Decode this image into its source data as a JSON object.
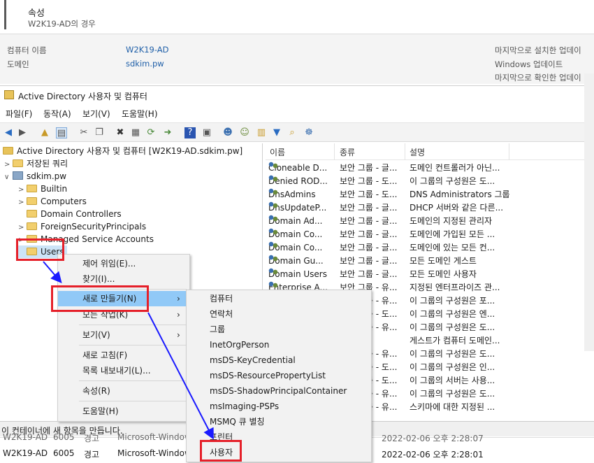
{
  "properties": {
    "title": "속성",
    "subtitle": "W2K19-AD의 경우",
    "computer_name_label": "컴퓨터 이름",
    "computer_name_value": "W2K19-AD",
    "domain_label": "도메인",
    "domain_value": "sdkim.pw",
    "right_items": [
      "마지막으로 설치한 업데이",
      "Windows 업데이트",
      "마지막으로 확인한 업데이"
    ]
  },
  "window": {
    "title": "Active Directory 사용자 및 컴퓨터",
    "close": "×"
  },
  "menubar": [
    "파일(F)",
    "동작(A)",
    "보기(V)",
    "도움말(H)"
  ],
  "tree": {
    "root": "Active Directory 사용자 및 컴퓨터 [W2K19-AD.sdkim.pw]",
    "saved_queries": "저장된 쿼리",
    "domain": "sdkim.pw",
    "children": [
      "Builtin",
      "Computers",
      "Domain Controllers",
      "ForeignSecurityPrincipals",
      "Managed Service Accounts",
      "Users"
    ]
  },
  "list": {
    "columns": [
      "이름",
      "종류",
      "설명"
    ],
    "rows": [
      {
        "name": "Cloneable D...",
        "type": "보안 그룹 - 글...",
        "desc": "도메인 컨트롤러가 아닌..."
      },
      {
        "name": "Denied ROD...",
        "type": "보안 그룹 - 도...",
        "desc": "이 그룹의 구성원은 도..."
      },
      {
        "name": "DnsAdmins",
        "type": "보안 그룹 - 도...",
        "desc": "DNS Administrators 그룹"
      },
      {
        "name": "DnsUpdateP...",
        "type": "보안 그룹 - 글...",
        "desc": "DHCP 서버와 같은 다른..."
      },
      {
        "name": "Domain Ad...",
        "type": "보안 그룹 - 글...",
        "desc": "도메인의 지정된 관리자"
      },
      {
        "name": "Domain Co...",
        "type": "보안 그룹 - 글...",
        "desc": "도메인에 가입된 모든 ..."
      },
      {
        "name": "Domain Co...",
        "type": "보안 그룹 - 글...",
        "desc": "도메인에 있는 모든 컨..."
      },
      {
        "name": "Domain Gu...",
        "type": "보안 그룹 - 글...",
        "desc": "모든 도메인 게스트"
      },
      {
        "name": "Domain Users",
        "type": "보안 그룹 - 글...",
        "desc": "모든 도메인 사용자"
      },
      {
        "name": "Enterprise A...",
        "type": "보안 그룹 - 유...",
        "desc": "지정된 엔터프라이즈 관..."
      },
      {
        "name": "",
        "type": "보안 그룹 - 유...",
        "desc": "이 그룹의 구성원은 포..."
      },
      {
        "name": "",
        "type": "보안 그룹 - 도...",
        "desc": "이 그룹의 구성원은 엔..."
      },
      {
        "name": "",
        "type": "보안 그룹 - 유...",
        "desc": "이 그룹의 구성원은 도..."
      },
      {
        "name": "",
        "type": "",
        "desc": "게스트가 컴퓨터 도메인..."
      },
      {
        "name": "",
        "type": "보안 그룹 - 유...",
        "desc": "이 그룹의 구성원은 도..."
      },
      {
        "name": "",
        "type": "보안 그룹 - 도...",
        "desc": "이 그룹의 구성원은 인..."
      },
      {
        "name": "",
        "type": "보안 그룹 - 도...",
        "desc": "이 그룹의 서버는 사용..."
      },
      {
        "name": "",
        "type": "보안 그룹 - 유...",
        "desc": "이 그룹의 구성원은 도..."
      },
      {
        "name": "",
        "type": "보안 그룹 - 유...",
        "desc": "스키마에 대한 지정된 ..."
      }
    ]
  },
  "status": "이 컨테이너에 새 항목을 만듭니다.",
  "events": {
    "row1": {
      "server": "W2K19-AD",
      "id": "6005",
      "level": "경고",
      "source": "Microsoft-Windows-",
      "date": "2022-02-06 오후 2:28:07"
    },
    "row2": {
      "server": "W2K19-AD",
      "id": "6005",
      "level": "경고",
      "source": "Microsoft-Windows-",
      "date": "2022-02-06 오후 2:28:01"
    }
  },
  "context_menu": {
    "delegate": "제어 위임(E)...",
    "find": "찾기(I)...",
    "new": "새로 만들기(N)",
    "all_tasks": "모든 작업(K)",
    "view": "보기(V)",
    "refresh": "새로 고침(F)",
    "export": "목록 내보내기(L)...",
    "properties": "속성(R)",
    "help": "도움말(H)"
  },
  "submenu": [
    "컴퓨터",
    "연락처",
    "그룹",
    "InetOrgPerson",
    "msDS-KeyCredential",
    "msDS-ResourcePropertyList",
    "msDS-ShadowPrincipalContainer",
    "msImaging-PSPs",
    "MSMQ 큐 별칭",
    "프린터",
    "사용자"
  ],
  "colors": {
    "highlight": "#91c9f7",
    "annotation_red": "#e5202a",
    "annotation_arrow": "#1a1aff"
  }
}
